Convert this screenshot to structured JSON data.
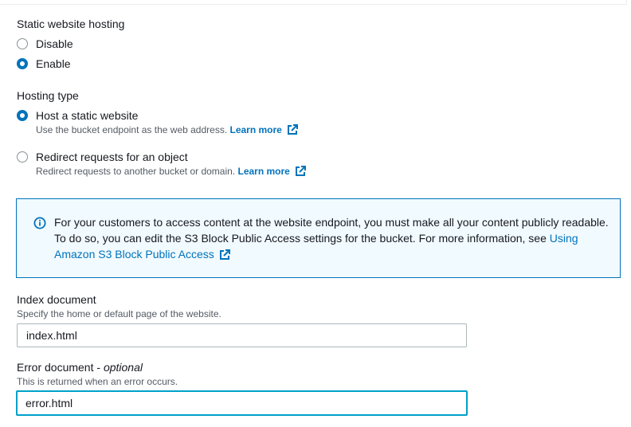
{
  "static_hosting": {
    "label": "Static website hosting",
    "options": [
      {
        "label": "Disable",
        "checked": false
      },
      {
        "label": "Enable",
        "checked": true
      }
    ]
  },
  "hosting_type": {
    "label": "Hosting type",
    "options": [
      {
        "label": "Host a static website",
        "description": "Use the bucket endpoint as the web address.",
        "link": "Learn more",
        "checked": true
      },
      {
        "label": "Redirect requests for an object",
        "description": "Redirect requests to another bucket or domain.",
        "link": "Learn more",
        "checked": false
      }
    ]
  },
  "alert": {
    "icon": "info-icon",
    "text": "For your customers to access content at the website endpoint, you must make all your content publicly readable. To do so, you can edit the S3 Block Public Access settings for the bucket. For more information, see",
    "link": "Using Amazon S3 Block Public Access"
  },
  "index_document": {
    "label": "Index document",
    "description": "Specify the home or default page of the website.",
    "value": "index.html"
  },
  "error_document": {
    "label": "Error document -",
    "optional": "optional",
    "description": "This is returned when an error occurs.",
    "value": "error.html"
  },
  "colors": {
    "accent": "#0073bb",
    "focus": "#00a1c9",
    "alert_bg": "#f1faff"
  }
}
